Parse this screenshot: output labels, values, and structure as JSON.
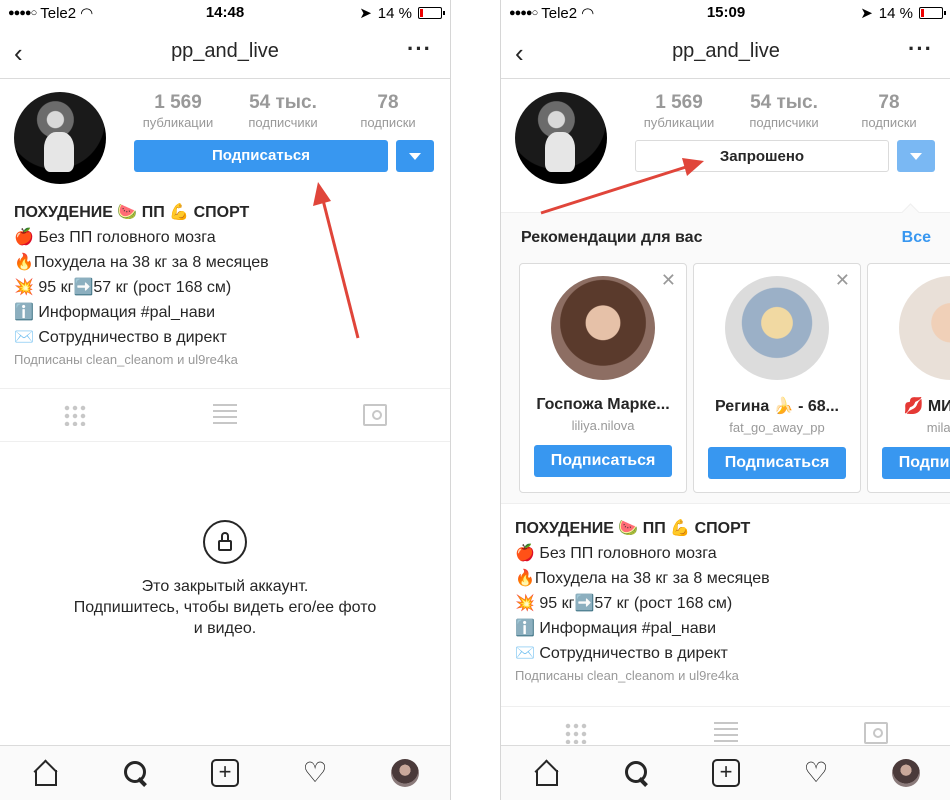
{
  "colors": {
    "accent": "#3897f0",
    "arrow": "#e0453a",
    "muted": "#999999"
  },
  "status_left": {
    "carrier": "Tele2",
    "time": "14:48",
    "battery": "14 %"
  },
  "status_right": {
    "carrier": "Tele2",
    "time": "15:09",
    "battery": "14 %"
  },
  "profile": {
    "username": "pp_and_live",
    "posts_count": "1 569",
    "posts_label": "публикации",
    "followers_count": "54 тыс.",
    "followers_label": "подписчики",
    "following_count": "78",
    "following_label": "подписки"
  },
  "buttons": {
    "follow": "Подписаться",
    "requested": "Запрошено"
  },
  "bio": {
    "name": "ПОХУДЕНИЕ 🍉 ПП 💪 СПОРТ",
    "line1": "🍎 Без ПП головного мозга",
    "line2": "🔥Похудела на 38 кг за 8 месяцев",
    "line3": "💥 95 кг➡️57 кг (рост 168 см)",
    "line4": "ℹ️ Информация #pal_нави",
    "line5": "✉️ Сотрудничество в директ",
    "followed_by": "Подписаны clean_cleanom и ul9re4ka"
  },
  "private_message": {
    "line1": "Это закрытый аккаунт.",
    "line2": "Подпишитесь, чтобы видеть его/ее фото",
    "line3": "и видео."
  },
  "recommendations": {
    "title": "Рекомендации для вас",
    "see_all": "Все",
    "cards": [
      {
        "name": "Госпожа Марке...",
        "username": "liliya.nilova",
        "button": "Подписаться"
      },
      {
        "name": "Регина 🍌 - 68...",
        "username": "fat_go_away_pp",
        "button": "Подписаться"
      },
      {
        "name": "💋 МИЛАНА",
        "username": "milalena",
        "button": "Подписаться"
      }
    ]
  },
  "icons": {
    "back": "chevron-left-icon",
    "more": "more-icon",
    "grid": "grid-icon",
    "list": "list-icon",
    "tagged": "tagged-icon",
    "lock": "lock-icon",
    "home": "home-icon",
    "search": "search-icon",
    "add": "add-icon",
    "heart": "heart-icon",
    "profile": "profile-avatar-icon"
  }
}
